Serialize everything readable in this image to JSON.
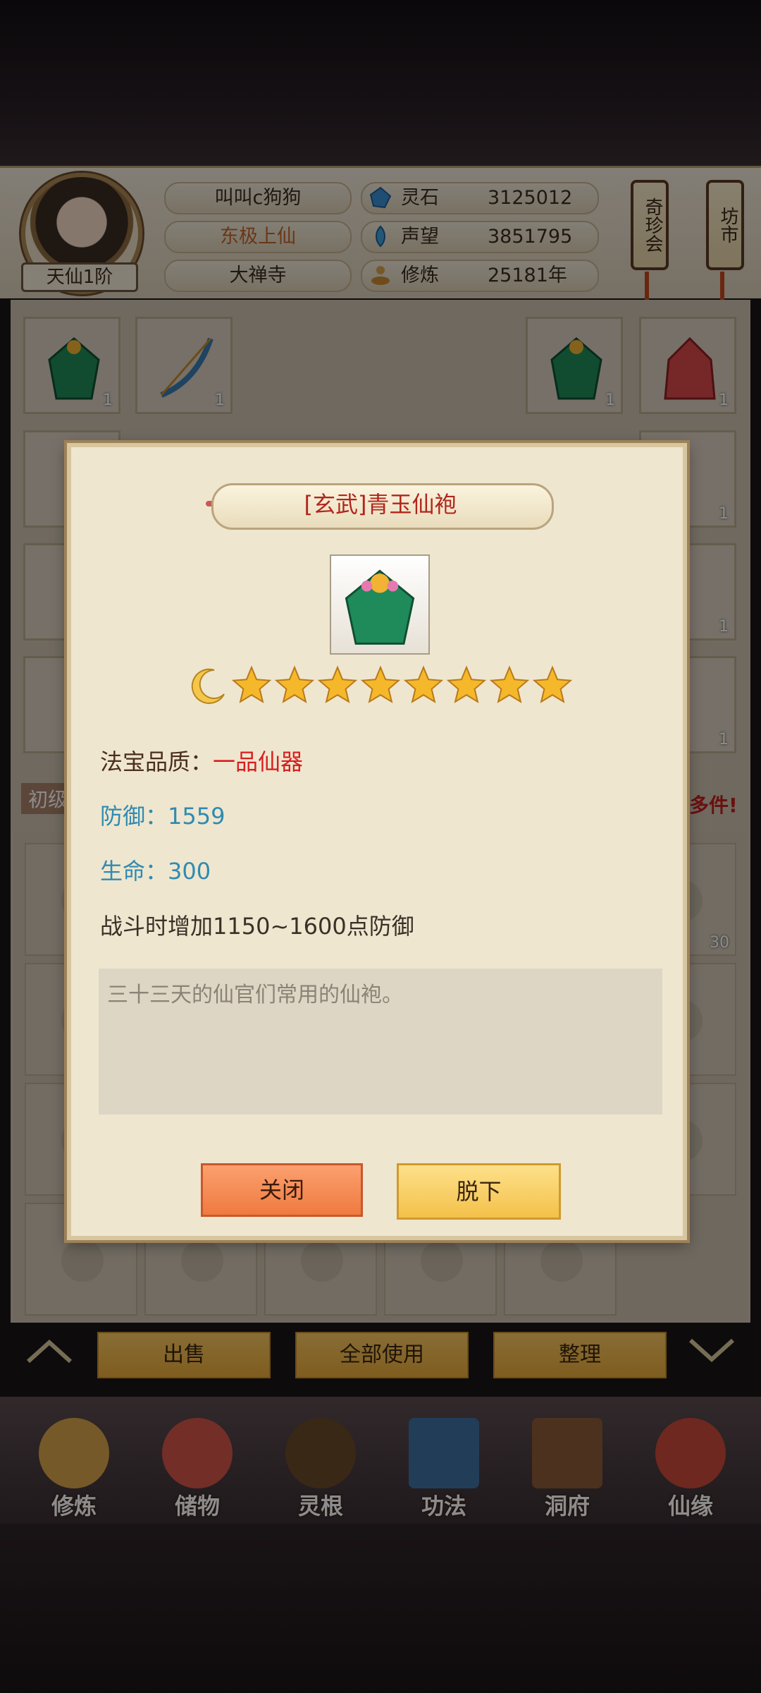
{
  "header": {
    "rank_badge": "天仙1阶",
    "player_name": "叫叫c狗狗",
    "title": "东极上仙",
    "sect": "大禅寺",
    "stats": [
      {
        "label": "灵石",
        "value": "3125012",
        "icon": "spirit-stone-icon"
      },
      {
        "label": "声望",
        "value": "3851795",
        "icon": "reputation-icon"
      },
      {
        "label": "修炼",
        "value": "25181年",
        "icon": "cultivation-icon"
      }
    ],
    "lanterns": [
      {
        "label": "奇珍会"
      },
      {
        "label": "坊市"
      }
    ]
  },
  "inventory": {
    "slot_counts": [
      "1",
      "1",
      "1",
      "1",
      "1",
      "1",
      "1",
      "1",
      "30"
    ],
    "side_labels": {
      "left": "初级",
      "right": "多件!"
    }
  },
  "actions": {
    "sell": "出售",
    "use_all": "全部使用",
    "sort": "整理"
  },
  "nav": [
    {
      "label": "修炼",
      "icon": "cultivate-nav-icon",
      "color": "#d8a24a"
    },
    {
      "label": "储物",
      "icon": "storage-bag-icon",
      "color": "#d2554a"
    },
    {
      "label": "灵根",
      "icon": "spirit-root-icon",
      "color": "#6b4a2a"
    },
    {
      "label": "功法",
      "icon": "technique-book-icon",
      "color": "#3f6fa0"
    },
    {
      "label": "洞府",
      "icon": "cave-dwelling-icon",
      "color": "#8a5a3a"
    },
    {
      "label": "仙缘",
      "icon": "fate-gourd-icon",
      "color": "#c84a3a"
    }
  ],
  "dialog": {
    "item_name": "[玄武]青玉仙袍",
    "star_count": 8,
    "quality_label": "法宝品质：",
    "quality_value": "一品仙器",
    "defense": "防御：1559",
    "life": "生命：300",
    "effect": "战斗时增加1150~1600点防御",
    "flavor": "三十三天的仙官们常用的仙袍。",
    "close_button": "关闭",
    "unequip_button": "脱下"
  },
  "colors": {
    "quality_red": "#d81e1e",
    "stat_blue": "#2f8bb0",
    "title_red": "#b1261c"
  }
}
